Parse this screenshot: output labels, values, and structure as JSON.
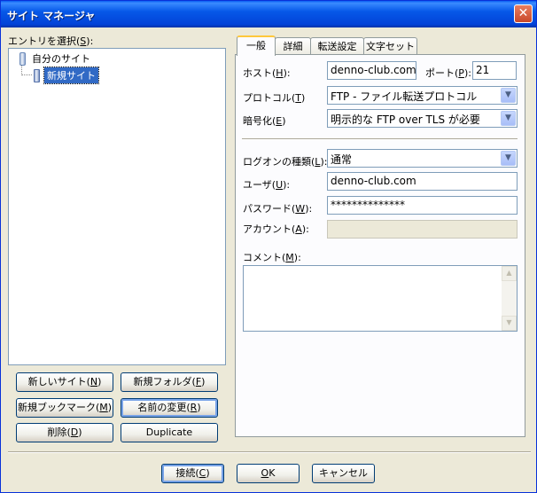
{
  "window": {
    "title": "サイト マネージャ",
    "close_glyph": "✕"
  },
  "left": {
    "entry_label": "エントリを選択(",
    "entry_key": "S",
    "entry_suffix": "):",
    "tree": {
      "root": "自分のサイト",
      "child": "新規サイト"
    },
    "buttons": {
      "new_site": {
        "text": "新しいサイト(",
        "key": "N",
        "end": ")"
      },
      "new_folder": {
        "text": "新規フォルダ(",
        "key": "F",
        "end": ")"
      },
      "new_bookmark": {
        "text": "新規ブックマーク(",
        "key": "M",
        "end": ")"
      },
      "rename": {
        "text": "名前の変更(",
        "key": "R",
        "end": ")"
      },
      "delete": {
        "text": "削除(",
        "key": "D",
        "end": ")"
      },
      "duplicate": "Duplicate"
    }
  },
  "tabs": [
    "一般",
    "詳細",
    "転送設定",
    "文字セット"
  ],
  "general": {
    "host": {
      "label": "ホスト(",
      "key": "H",
      "end": "):",
      "value": "denno-club.com"
    },
    "port": {
      "label": "ポート(",
      "key": "P",
      "end": "):",
      "value": "21"
    },
    "protocol": {
      "label": "プロトコル(",
      "key": "T",
      "end": ")",
      "value": "FTP - ファイル転送プロトコル"
    },
    "encryption": {
      "label": "暗号化(",
      "key": "E",
      "end": ")",
      "value": "明示的な FTP over TLS が必要"
    },
    "logon_type": {
      "label": "ログオンの種類(",
      "key": "L",
      "end": "):",
      "value": "通常"
    },
    "user": {
      "label": "ユーザ(",
      "key": "U",
      "end": "):",
      "value": "denno-club.com"
    },
    "password": {
      "label": "パスワード(",
      "key": "W",
      "end": "):",
      "value": "**************"
    },
    "account": {
      "label": "アカウント(",
      "key": "A",
      "end": "):",
      "value": ""
    },
    "comment": {
      "label": "コメント(",
      "key": "M",
      "end": "):",
      "value": ""
    }
  },
  "footer": {
    "connect": {
      "text": "接続(",
      "key": "C",
      "end": ")"
    },
    "ok": {
      "key": "O",
      "text": "K"
    },
    "cancel": "キャンセル"
  },
  "colors": {
    "title_bar": "#0658e8",
    "selection": "#316ac5",
    "tab_highlight": "#ffc83c",
    "dialog_bg": "#ece9d8"
  }
}
